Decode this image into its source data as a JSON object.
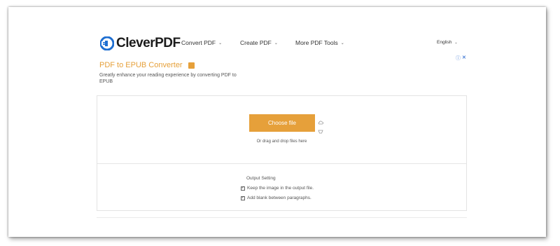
{
  "header": {
    "logo_text": "CleverPDF",
    "nav": [
      {
        "label": "Convert PDF",
        "chevron": "⌄"
      },
      {
        "label": "Create PDF",
        "chevron": "⌄"
      },
      {
        "label": "More PDF Tools",
        "chevron": "⌄"
      }
    ],
    "language": {
      "label": "English",
      "chevron": "⌄"
    }
  },
  "ad": {
    "info_icon": "ⓘ",
    "close_icon": "✕"
  },
  "page": {
    "title": "PDF to EPUB Converter",
    "description": "Greatly enhance your reading experience by converting PDF to EPUB"
  },
  "upload": {
    "choose_label": "Choose file",
    "drop_text": "Or drag and drop files here"
  },
  "output": {
    "heading": "Output Setting",
    "options": [
      {
        "label": "Keep the image in the output file.",
        "checked": true
      },
      {
        "label": "Add blank between paragraphs.",
        "checked": true
      }
    ]
  },
  "colors": {
    "accent": "#e6a03a",
    "logo_blue": "#1f6fd1"
  }
}
